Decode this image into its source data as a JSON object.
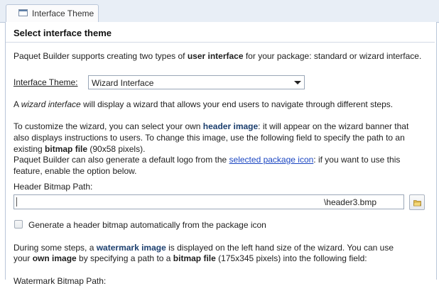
{
  "tab": {
    "label": "Interface Theme"
  },
  "section": {
    "title": "Select interface theme"
  },
  "intro": {
    "before": "Paquet Builder supports creating two types of ",
    "bold": "user interface",
    "after": " for your package: standard or wizard interface."
  },
  "theme": {
    "label": "Interface Theme:",
    "value": "Wizard Interface"
  },
  "wizard_desc": {
    "before": "A ",
    "italic": "wizard interface",
    "after": " will display a wizard that allows your end users to navigate through different steps."
  },
  "customize": {
    "line1_before": "To customize the wizard, you can select your own ",
    "line1_kw": "header image",
    "line1_after": ": it will appear on the wizard banner that",
    "line2": "also displays instructions to users. To change this image, use the following field to specify the path to an",
    "line3_before": "existing ",
    "line3_bold": "bitmap file",
    "line3_after": " (90x58 pixels).",
    "line4_before": "Paquet Builder can also generate a default logo from the ",
    "line4_link": "selected package icon",
    "line4_after": ": if you want to use this",
    "line5": "feature, enable the option below."
  },
  "header_path": {
    "label": "Header Bitmap Path:",
    "value": "\\header3.bmp"
  },
  "auto_header": {
    "label": "Generate a header bitmap automatically from the package icon",
    "checked": false
  },
  "watermark": {
    "line1_before": "During some steps, a ",
    "line1_kw": "watermark image",
    "line1_after": " is displayed on the left hand size of the wizard. You can use",
    "line2_before": "your ",
    "line2_bold": "own image",
    "line2_mid": " by specifying a path to a ",
    "line2_bold2": "bitmap file",
    "line2_after": " (175x345 pixels) into the following field:"
  },
  "watermark_path": {
    "label": "Watermark Bitmap Path:"
  },
  "icons": {
    "tab": "window-tab-icon",
    "browse": "folder-icon"
  }
}
